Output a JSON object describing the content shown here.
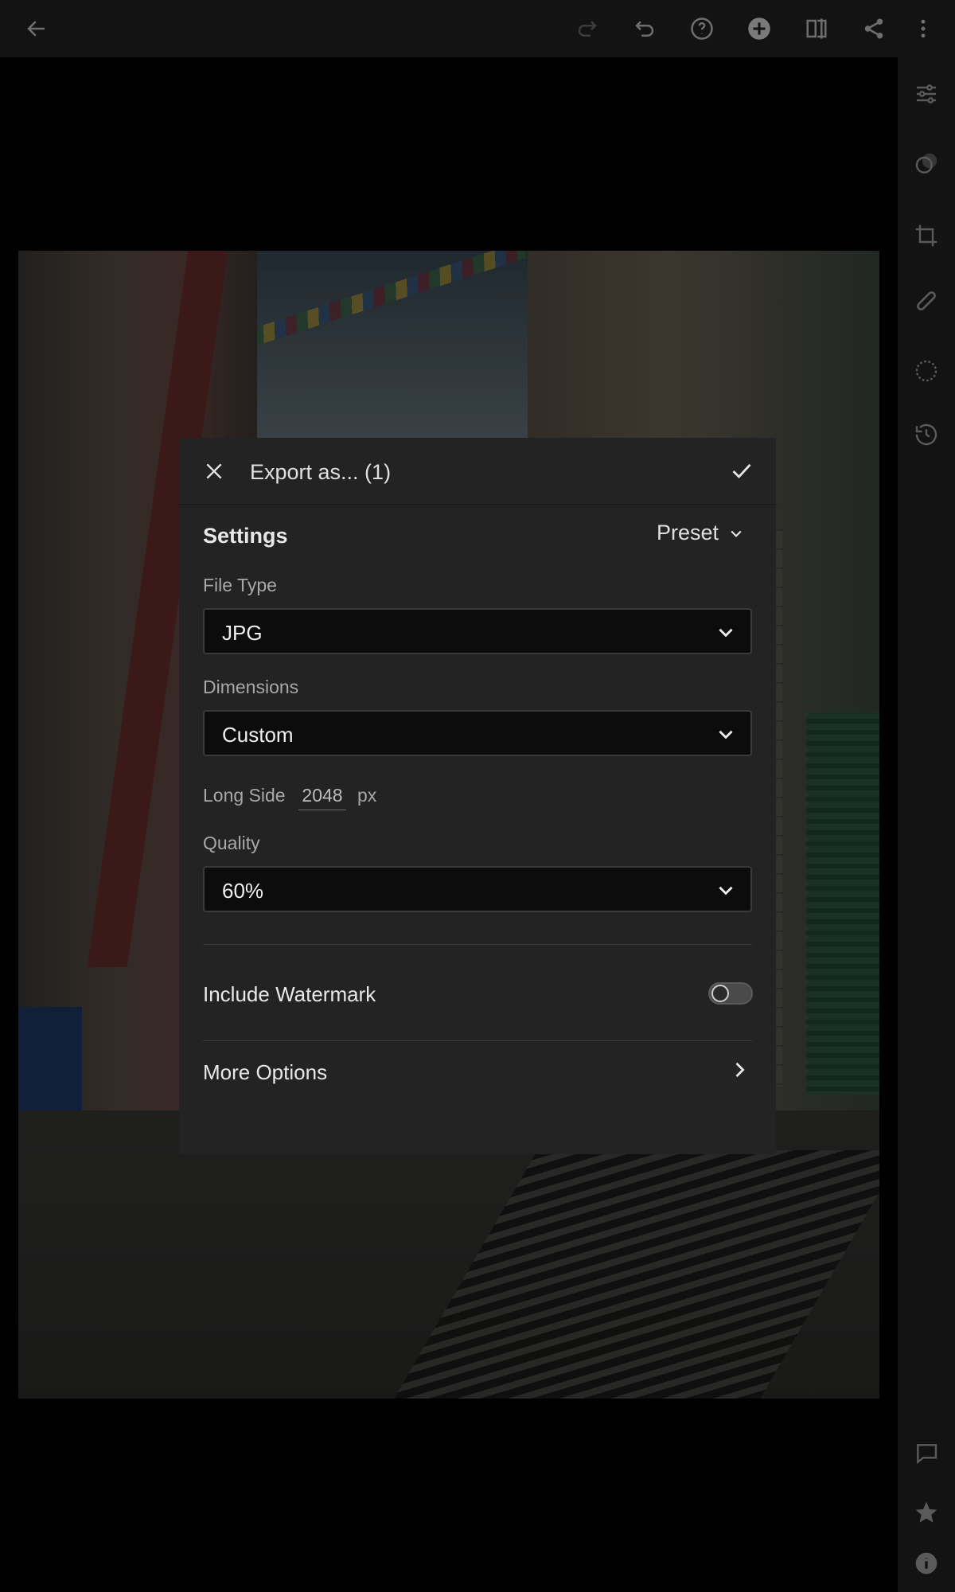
{
  "dialog": {
    "title": "Export as... (1)",
    "settings_label": "Settings",
    "preset_label": "Preset",
    "file_type": {
      "label": "File Type",
      "value": "JPG"
    },
    "dimensions": {
      "label": "Dimensions",
      "value": "Custom"
    },
    "long_side": {
      "label": "Long Side",
      "value": "2048",
      "unit": "px"
    },
    "quality": {
      "label": "Quality",
      "value": "60%"
    },
    "watermark": {
      "label": "Include Watermark",
      "enabled": false
    },
    "more_options": {
      "label": "More Options"
    }
  },
  "icons": {
    "top": [
      "back-arrow-icon",
      "redo-icon",
      "undo-icon",
      "help-icon",
      "add-icon",
      "compare-icon",
      "share-icon",
      "more-vertical-icon"
    ],
    "right": [
      "edit-sliders-icon",
      "presets-icon",
      "crop-icon",
      "healing-icon",
      "masking-icon",
      "history-icon",
      "comment-icon",
      "star-icon",
      "info-icon"
    ]
  },
  "colors": {
    "background": "#000000",
    "toolbar": "#131313",
    "dialog": "#232323",
    "field": "#0c0c0c"
  }
}
